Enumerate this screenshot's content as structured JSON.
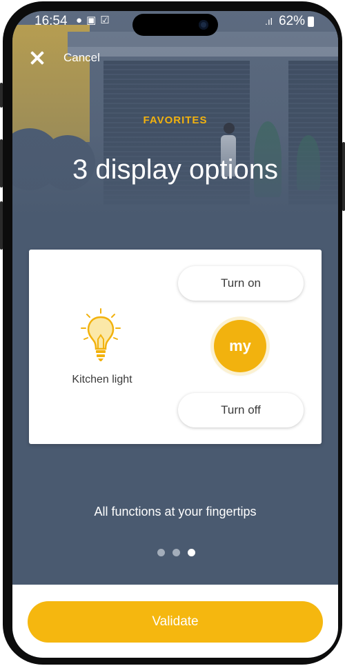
{
  "status_bar": {
    "time": "16:54",
    "notification_icons": [
      "location-pin-icon",
      "image-icon",
      "check-box-icon"
    ],
    "signal": ".ıl",
    "battery": "62%"
  },
  "header": {
    "cancel_label": "Cancel"
  },
  "onboarding": {
    "kicker": "FAVORITES",
    "title": "3 display options",
    "tagline": "All functions at your fingertips",
    "page_count": 3,
    "active_page": 3
  },
  "card": {
    "device_label": "Kitchen light",
    "turn_on_label": "Turn on",
    "my_label": "my",
    "turn_off_label": "Turn off"
  },
  "footer": {
    "validate_label": "Validate"
  },
  "colors": {
    "accent": "#f2b20e",
    "background": "#4a5a70",
    "card": "#ffffff"
  }
}
